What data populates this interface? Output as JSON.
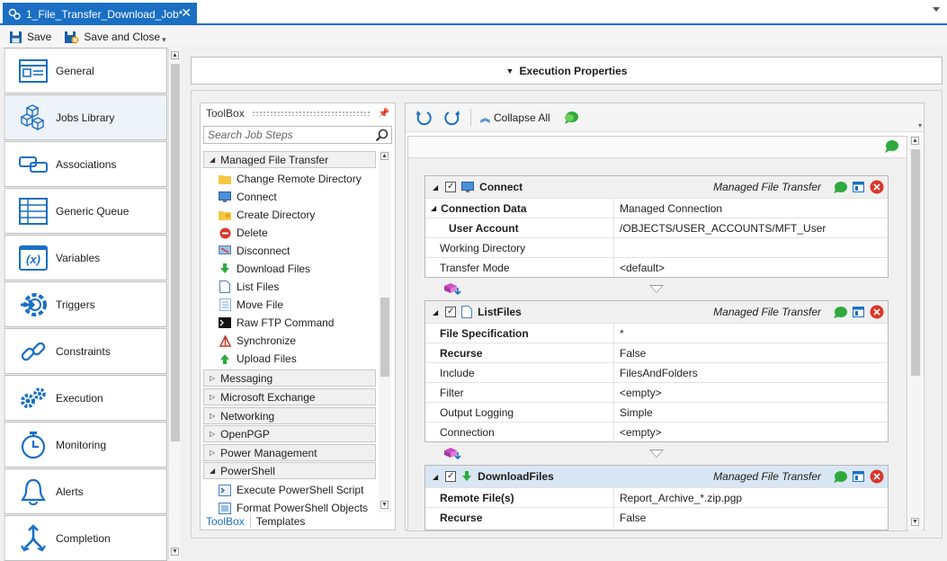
{
  "tab": {
    "title": "1_File_Transfer_Download_Job*",
    "close": "✕"
  },
  "toolbar": {
    "save": "Save",
    "save_close": "Save and Close"
  },
  "sidebar": {
    "items": [
      {
        "label": "General",
        "icon": "general-icon"
      },
      {
        "label": "Jobs Library",
        "icon": "cubes-icon"
      },
      {
        "label": "Associations",
        "icon": "link-icon"
      },
      {
        "label": "Generic Queue",
        "icon": "queue-icon"
      },
      {
        "label": "Variables",
        "icon": "variable-icon",
        "glyph": "(x)"
      },
      {
        "label": "Triggers",
        "icon": "trigger-icon"
      },
      {
        "label": "Constraints",
        "icon": "chain-icon"
      },
      {
        "label": "Execution",
        "icon": "gears-icon"
      },
      {
        "label": "Monitoring",
        "icon": "stopwatch-icon"
      },
      {
        "label": "Alerts",
        "icon": "bell-icon"
      },
      {
        "label": "Completion",
        "icon": "split-arrow-icon"
      }
    ]
  },
  "main": {
    "section_title": "Execution Properties"
  },
  "toolbox": {
    "title": "ToolBox",
    "search_placeholder": "Search Job Steps",
    "categories": {
      "mft": "Managed File Transfer",
      "messaging": "Messaging",
      "exchange": "Microsoft Exchange",
      "networking": "Networking",
      "openpgp": "OpenPGP",
      "power": "Power Management",
      "powershell": "PowerShell"
    },
    "mft_steps": [
      "Change Remote Directory",
      "Connect",
      "Create Directory",
      "Delete",
      "Disconnect",
      "Download Files",
      "List Files",
      "Move File",
      "Raw FTP Command",
      "Synchronize",
      "Upload Files"
    ],
    "ps_steps": [
      "Execute PowerShell Script",
      "Format PowerShell Objects"
    ],
    "tabs": {
      "toolbox": "ToolBox",
      "templates": "Templates"
    }
  },
  "designer": {
    "collapse_all": "Collapse All",
    "steps": [
      {
        "name": "Connect",
        "category": "Managed File Transfer",
        "props": [
          {
            "n": "Connection Data",
            "v": "Managed Connection"
          },
          {
            "n": "User Account",
            "v": "/OBJECTS/USER_ACCOUNTS/MFT_User"
          },
          {
            "n": "Working Directory",
            "v": ""
          },
          {
            "n": "Transfer Mode",
            "v": "<default>"
          }
        ]
      },
      {
        "name": "ListFiles",
        "category": "Managed File Transfer",
        "props": [
          {
            "n": "File Specification",
            "v": "*"
          },
          {
            "n": "Recurse",
            "v": "False"
          },
          {
            "n": "Include",
            "v": "FilesAndFolders"
          },
          {
            "n": "Filter",
            "v": "<empty>"
          },
          {
            "n": "Output Logging",
            "v": "Simple"
          },
          {
            "n": "Connection",
            "v": "<empty>"
          }
        ]
      },
      {
        "name": "DownloadFiles",
        "category": "Managed File Transfer",
        "props": [
          {
            "n": "Remote File(s)",
            "v": "Report_Archive_*.zip.pgp"
          },
          {
            "n": "Recurse",
            "v": "False"
          }
        ]
      }
    ]
  },
  "colors": {
    "accent": "#1a6fc4",
    "selected_step": "#d9e6f3"
  }
}
